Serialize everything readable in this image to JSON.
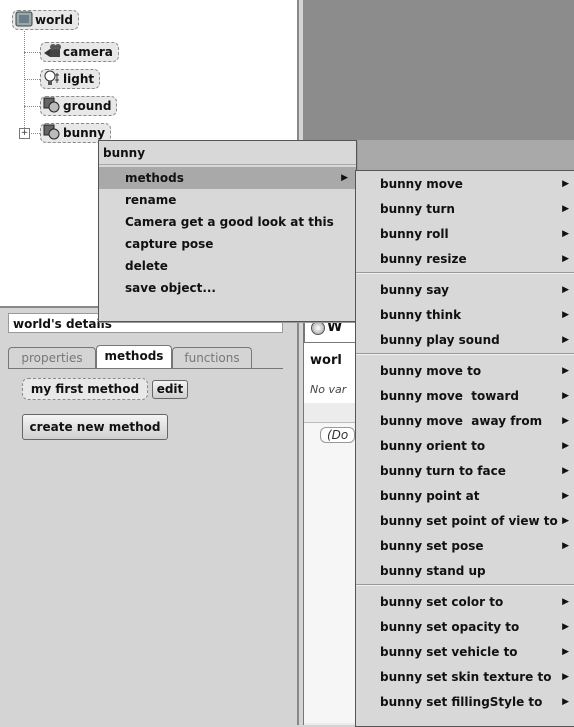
{
  "tree": {
    "root": "world",
    "children": [
      "camera",
      "light",
      "ground",
      "bunny"
    ]
  },
  "details": {
    "title": "world's details",
    "tabs": [
      "properties",
      "methods",
      "functions"
    ],
    "method_name": "my first method",
    "edit_label": "edit",
    "create_label": "create new method"
  },
  "editor": {
    "tab_label": "W",
    "header_title": "worl",
    "no_vars_text": "No var",
    "do_label": "(Do"
  },
  "context_menu": {
    "title": "bunny",
    "items": [
      {
        "label": "methods",
        "submenu": true,
        "selected": true
      },
      {
        "label": "rename",
        "submenu": false
      },
      {
        "label": "Camera get a good look at this",
        "submenu": false
      },
      {
        "label": "capture pose",
        "submenu": false
      },
      {
        "label": "delete",
        "submenu": false
      },
      {
        "label": "save object...",
        "submenu": false
      }
    ]
  },
  "submenu": {
    "groups": [
      [
        {
          "label": "bunny move",
          "arrow": true
        },
        {
          "label": "bunny turn",
          "arrow": true
        },
        {
          "label": "bunny roll",
          "arrow": true
        },
        {
          "label": "bunny resize",
          "arrow": true
        }
      ],
      [
        {
          "label": "bunny say",
          "arrow": true
        },
        {
          "label": "bunny think",
          "arrow": true
        },
        {
          "label": "bunny play sound",
          "arrow": true
        }
      ],
      [
        {
          "label": "bunny move to",
          "arrow": true
        },
        {
          "label": "bunny move  toward",
          "arrow": true
        },
        {
          "label": "bunny move  away from",
          "arrow": true
        },
        {
          "label": "bunny orient to",
          "arrow": true
        },
        {
          "label": "bunny turn to face",
          "arrow": true
        },
        {
          "label": "bunny point at",
          "arrow": true
        },
        {
          "label": "bunny set point of view to",
          "arrow": true
        },
        {
          "label": "bunny set pose",
          "arrow": true
        },
        {
          "label": "bunny stand up",
          "arrow": false
        }
      ],
      [
        {
          "label": "bunny set color to",
          "arrow": true
        },
        {
          "label": "bunny set opacity to",
          "arrow": true
        },
        {
          "label": "bunny set vehicle to",
          "arrow": true
        },
        {
          "label": "bunny set skin texture to",
          "arrow": true
        },
        {
          "label": "bunny set fillingStyle to",
          "arrow": true
        }
      ]
    ]
  },
  "icons": {
    "world": "globe-icon",
    "camera": "camera-icon",
    "light": "lightbulb-icon",
    "ground": "object-icon",
    "bunny": "object-icon",
    "submenu_arrow": "triangle-right-icon",
    "expander": "plus-icon"
  },
  "colors": {
    "menu_bg": "#d8d8d8",
    "menu_selected": "#a9a9a9",
    "tree_bg": "#ffffff",
    "world_view": "#8c8c8c"
  }
}
